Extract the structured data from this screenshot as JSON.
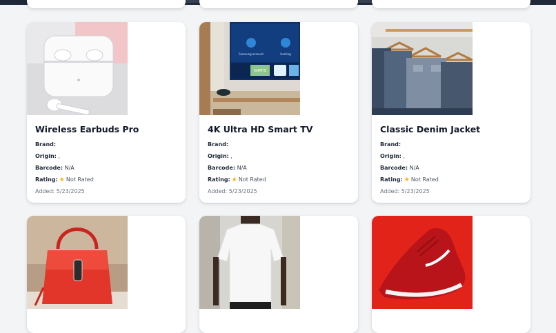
{
  "labels": {
    "brand": "Brand:",
    "origin": "Origin:",
    "barcode": "Barcode:",
    "rating": "Rating:"
  },
  "products": [
    {
      "title": "Wireless Earbuds Pro",
      "brand": "",
      "origin": ",",
      "barcode": "N/A",
      "rating": "Not Rated",
      "added": "Added: 5/23/2025",
      "image_icon": "earbuds-image"
    },
    {
      "title": "4K Ultra HD Smart TV",
      "brand": "",
      "origin": ",",
      "barcode": "N/A",
      "rating": "Not Rated",
      "added": "Added: 5/23/2025",
      "image_icon": "smart-tv-image",
      "tv_screen": {
        "tile1": "Samsung account",
        "tile2": "Hosting",
        "badge": "GRATIS"
      }
    },
    {
      "title": "Classic Denim Jacket",
      "brand": "",
      "origin": ",",
      "barcode": "N/A",
      "rating": "Not Rated",
      "added": "Added: 5/23/2025",
      "image_icon": "denim-jacket-image"
    },
    {
      "image_icon": "red-handbag-image"
    },
    {
      "image_icon": "white-tshirt-image"
    },
    {
      "image_icon": "red-sneaker-image"
    }
  ],
  "colors": {
    "background": "#f3f4f6",
    "card": "#ffffff",
    "star": "#f5b301"
  }
}
